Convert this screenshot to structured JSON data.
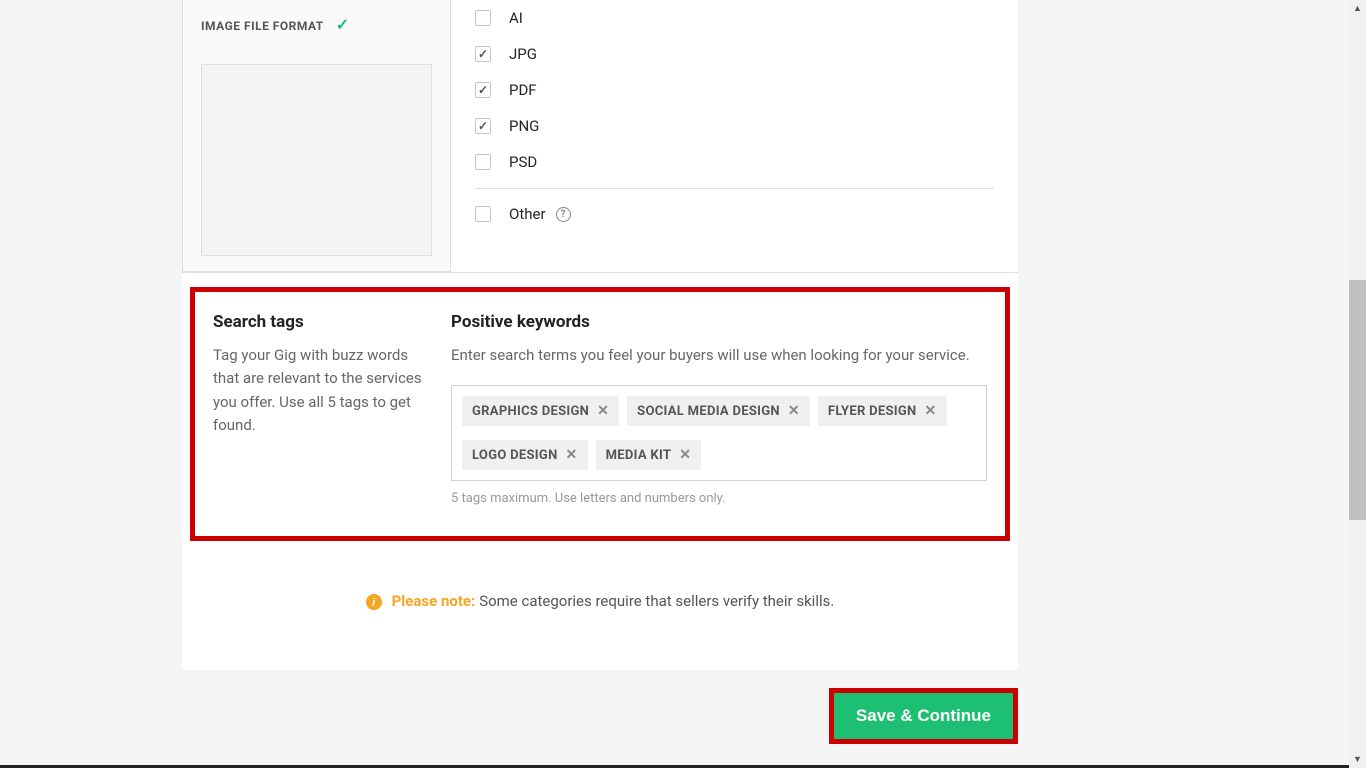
{
  "file_format": {
    "label": "IMAGE FILE FORMAT",
    "options": [
      {
        "label": "AI",
        "checked": false
      },
      {
        "label": "JPG",
        "checked": true
      },
      {
        "label": "PDF",
        "checked": true
      },
      {
        "label": "PNG",
        "checked": true
      },
      {
        "label": "PSD",
        "checked": false
      }
    ],
    "other_label": "Other",
    "other_checked": false
  },
  "search_tags": {
    "title": "Search tags",
    "description": "Tag your Gig with buzz words that are relevant to the services you offer. Use all 5 tags to get found.",
    "keywords_title": "Positive keywords",
    "keywords_description": "Enter search terms you feel your buyers will use when looking for your service.",
    "tags": [
      "GRAPHICS DESIGN",
      "SOCIAL MEDIA DESIGN",
      "FLYER DESIGN",
      "LOGO DESIGN",
      "MEDIA KIT"
    ],
    "hint": "5 tags maximum. Use letters and numbers only."
  },
  "note": {
    "label": "Please note:",
    "text": " Some categories require that sellers verify their skills."
  },
  "buttons": {
    "save_continue": "Save & Continue"
  }
}
